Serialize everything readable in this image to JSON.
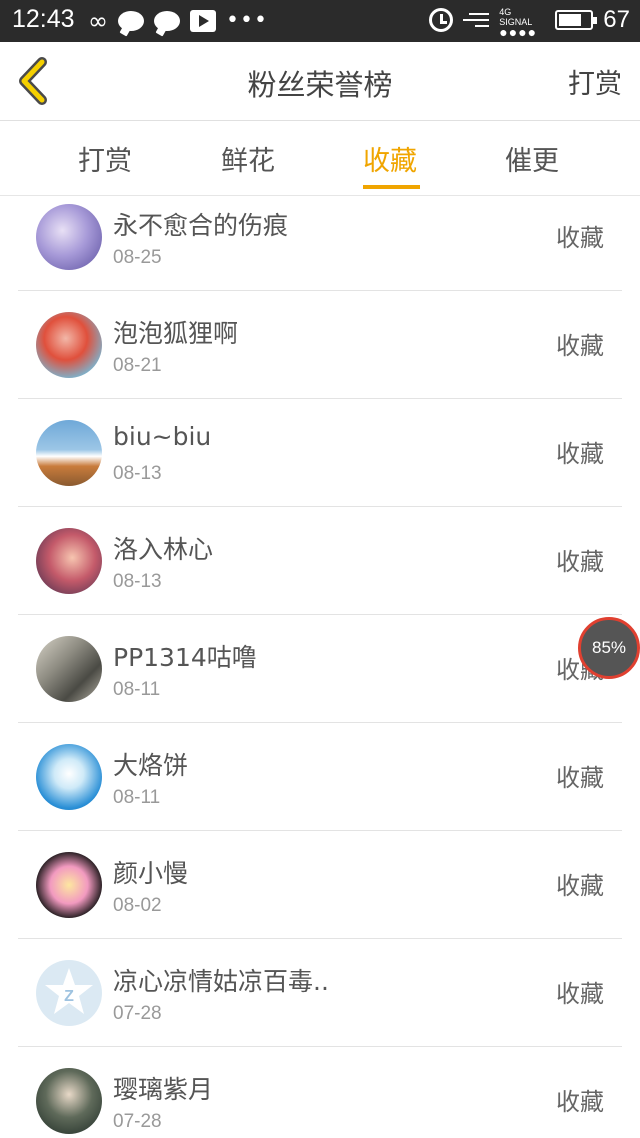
{
  "status_bar": {
    "time": "12:43",
    "left_icons": [
      "infinity-icon",
      "chat-bubble-icon",
      "chat-bubble-icon",
      "play-icon",
      "more-dots-icon"
    ],
    "right_icons": [
      "alarm-icon",
      "data-icon",
      "signal-icon",
      "battery-icon"
    ],
    "network": "4G",
    "signal_label": "SIGNAL",
    "battery_level": "67"
  },
  "header": {
    "back_icon": "chevron-left-icon",
    "title": "粉丝荣誉榜",
    "right_action": "打赏"
  },
  "tabs": [
    {
      "label": "打赏",
      "active": false
    },
    {
      "label": "鲜花",
      "active": false
    },
    {
      "label": "收藏",
      "active": true
    },
    {
      "label": "催更",
      "active": false
    }
  ],
  "list": {
    "items": [
      {
        "name": "永不愈合的伤痕",
        "date": "08-25",
        "action": "收藏"
      },
      {
        "name": "泡泡狐狸啊",
        "date": "08-21",
        "action": "收藏"
      },
      {
        "name": "biu~biu",
        "date": "08-13",
        "action": "收藏"
      },
      {
        "name": "洛入林心",
        "date": "08-13",
        "action": "收藏"
      },
      {
        "name": "PP1314咕噜",
        "date": "08-11",
        "action": "收藏"
      },
      {
        "name": "大烙饼",
        "date": "08-11",
        "action": "收藏"
      },
      {
        "name": "颜小慢",
        "date": "08-02",
        "action": "收藏"
      },
      {
        "name": "凉心凉情姑凉百毒..",
        "date": "07-28",
        "action": "收藏"
      },
      {
        "name": "璎璃紫月",
        "date": "07-28",
        "action": "收藏"
      }
    ]
  },
  "float_badge": {
    "value": "85%"
  },
  "colors": {
    "accent": "#f0a500",
    "status_bar_bg": "#2b2b2b",
    "divider": "#e3e3e3"
  }
}
